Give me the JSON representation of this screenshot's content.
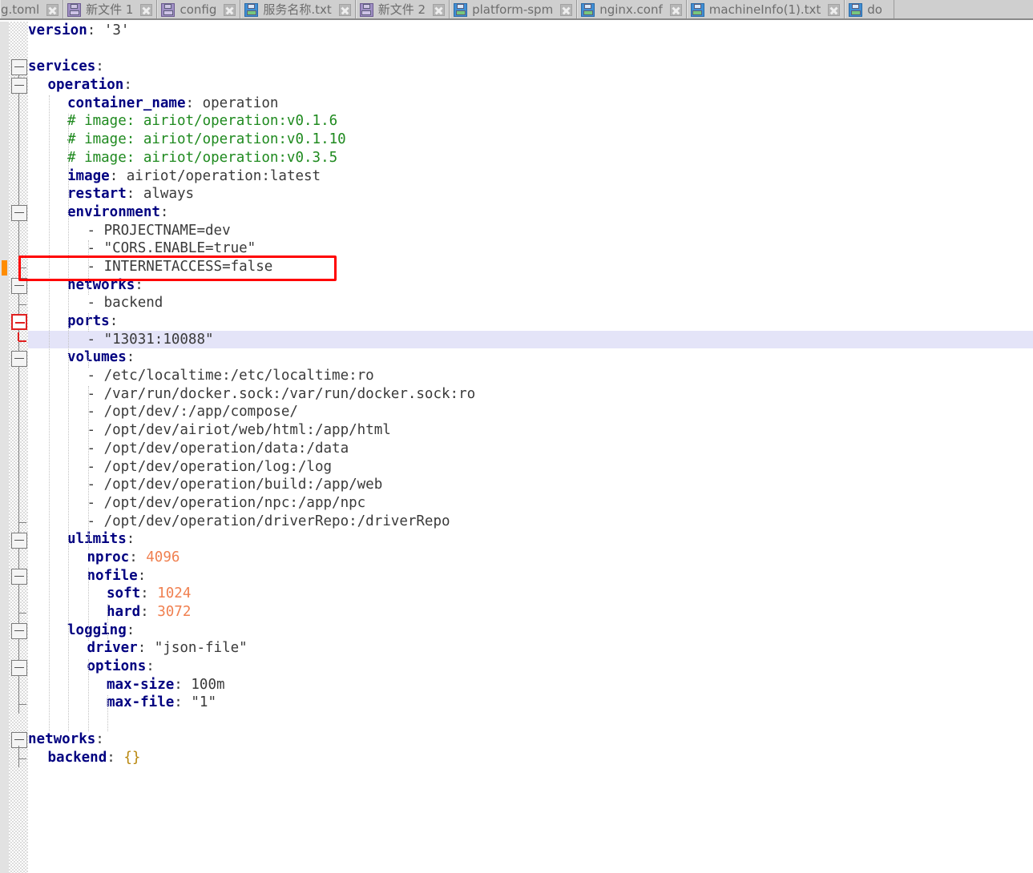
{
  "tabbar": {
    "tabs": [
      {
        "label": "g.toml",
        "icon": "floppy-icon",
        "state": "truncated",
        "close_label": "x"
      },
      {
        "label": "新文件 1",
        "icon": "floppy-icon",
        "state": "modified",
        "close_label": "x"
      },
      {
        "label": "config",
        "icon": "floppy-icon",
        "state": "modified",
        "close_label": "x"
      },
      {
        "label": "服务名称.txt",
        "icon": "floppy-icon",
        "state": "saved",
        "close_label": "x"
      },
      {
        "label": "新文件 2",
        "icon": "floppy-icon",
        "state": "modified",
        "close_label": "x"
      },
      {
        "label": "platform-spm",
        "icon": "floppy-icon",
        "state": "saved",
        "close_label": "x"
      },
      {
        "label": "nginx.conf",
        "icon": "floppy-icon",
        "state": "saved",
        "close_label": "x"
      },
      {
        "label": "machineInfo(1).txt",
        "icon": "floppy-icon",
        "state": "saved",
        "close_label": "x"
      },
      {
        "label": "do",
        "icon": "floppy-icon",
        "state": "saved",
        "close_label": "x"
      }
    ]
  },
  "annotation": {
    "color": "#ff0000",
    "target_text": "- INTERNETACCESS=false"
  },
  "colors": {
    "key": "#000080",
    "comment": "#1f8a1f",
    "number": "#f08050",
    "value": "#3a3a3a",
    "current_line": "#e4e4f8",
    "change_marker": "#ff8c00",
    "fold_highlight": "#e02020"
  },
  "editor": {
    "language": "yaml",
    "current_line_text": "    - \"13031:10088\"",
    "lines": [
      {
        "n": 1,
        "indent": 0,
        "parts": [
          {
            "t": "version",
            "c": "k"
          },
          {
            "t": ": ",
            "c": "v"
          },
          {
            "t": "'3'",
            "c": "s"
          }
        ]
      },
      {
        "n": 2,
        "indent": 0,
        "parts": []
      },
      {
        "n": 3,
        "indent": 0,
        "parts": [
          {
            "t": "services",
            "c": "k"
          },
          {
            "t": ":",
            "c": "v"
          }
        ]
      },
      {
        "n": 4,
        "indent": 1,
        "parts": [
          {
            "t": "operation",
            "c": "k"
          },
          {
            "t": ":",
            "c": "v"
          }
        ]
      },
      {
        "n": 5,
        "indent": 2,
        "parts": [
          {
            "t": "container_name",
            "c": "k"
          },
          {
            "t": ": operation",
            "c": "v"
          }
        ]
      },
      {
        "n": 6,
        "indent": 2,
        "parts": [
          {
            "t": "# image: airiot/operation:v0.1.6",
            "c": "c"
          }
        ]
      },
      {
        "n": 7,
        "indent": 2,
        "parts": [
          {
            "t": "# image: airiot/operation:v0.1.10",
            "c": "c"
          }
        ]
      },
      {
        "n": 8,
        "indent": 2,
        "parts": [
          {
            "t": "# image: airiot/operation:v0.3.5",
            "c": "c"
          }
        ]
      },
      {
        "n": 9,
        "indent": 2,
        "parts": [
          {
            "t": "image",
            "c": "k"
          },
          {
            "t": ": airiot/operation:latest",
            "c": "v"
          }
        ]
      },
      {
        "n": 10,
        "indent": 2,
        "parts": [
          {
            "t": "restart",
            "c": "k"
          },
          {
            "t": ": always",
            "c": "v"
          }
        ]
      },
      {
        "n": 11,
        "indent": 2,
        "parts": [
          {
            "t": "environment",
            "c": "k"
          },
          {
            "t": ":",
            "c": "v"
          }
        ]
      },
      {
        "n": 12,
        "indent": 3,
        "parts": [
          {
            "t": "- PROJECTNAME=dev",
            "c": "v"
          }
        ]
      },
      {
        "n": 13,
        "indent": 3,
        "parts": [
          {
            "t": "- \"CORS.ENABLE=true\"",
            "c": "v"
          }
        ]
      },
      {
        "n": 14,
        "indent": 3,
        "parts": [
          {
            "t": "- INTERNETACCESS=false",
            "c": "v"
          }
        ]
      },
      {
        "n": 15,
        "indent": 2,
        "parts": [
          {
            "t": "networks",
            "c": "k"
          },
          {
            "t": ":",
            "c": "v"
          }
        ]
      },
      {
        "n": 16,
        "indent": 3,
        "parts": [
          {
            "t": "- backend",
            "c": "v"
          }
        ]
      },
      {
        "n": 17,
        "indent": 2,
        "parts": [
          {
            "t": "ports",
            "c": "k"
          },
          {
            "t": ":",
            "c": "v"
          }
        ]
      },
      {
        "n": 18,
        "indent": 3,
        "parts": [
          {
            "t": "- \"13031:10088\"",
            "c": "v"
          }
        ],
        "current": true
      },
      {
        "n": 19,
        "indent": 2,
        "parts": [
          {
            "t": "volumes",
            "c": "k"
          },
          {
            "t": ":",
            "c": "v"
          }
        ]
      },
      {
        "n": 20,
        "indent": 3,
        "parts": [
          {
            "t": "- /etc/localtime:/etc/localtime:ro",
            "c": "v"
          }
        ]
      },
      {
        "n": 21,
        "indent": 3,
        "parts": [
          {
            "t": "- /var/run/docker.sock:/var/run/docker.sock:ro",
            "c": "v"
          }
        ]
      },
      {
        "n": 22,
        "indent": 3,
        "parts": [
          {
            "t": "- /opt/dev/:/app/compose/",
            "c": "v"
          }
        ]
      },
      {
        "n": 23,
        "indent": 3,
        "parts": [
          {
            "t": "- /opt/dev/airiot/web/html:/app/html",
            "c": "v"
          }
        ]
      },
      {
        "n": 24,
        "indent": 3,
        "parts": [
          {
            "t": "- /opt/dev/operation/data:/data",
            "c": "v"
          }
        ]
      },
      {
        "n": 25,
        "indent": 3,
        "parts": [
          {
            "t": "- /opt/dev/operation/log:/log",
            "c": "v"
          }
        ]
      },
      {
        "n": 26,
        "indent": 3,
        "parts": [
          {
            "t": "- /opt/dev/operation/build:/app/web",
            "c": "v"
          }
        ]
      },
      {
        "n": 27,
        "indent": 3,
        "parts": [
          {
            "t": "- /opt/dev/operation/npc:/app/npc",
            "c": "v"
          }
        ]
      },
      {
        "n": 28,
        "indent": 3,
        "parts": [
          {
            "t": "- /opt/dev/operation/driverRepo:/driverRepo",
            "c": "v"
          }
        ]
      },
      {
        "n": 29,
        "indent": 2,
        "parts": [
          {
            "t": "ulimits",
            "c": "k"
          },
          {
            "t": ":",
            "c": "v"
          }
        ]
      },
      {
        "n": 30,
        "indent": 3,
        "parts": [
          {
            "t": "nproc",
            "c": "k"
          },
          {
            "t": ": ",
            "c": "v"
          },
          {
            "t": "4096",
            "c": "n"
          }
        ]
      },
      {
        "n": 31,
        "indent": 3,
        "parts": [
          {
            "t": "nofile",
            "c": "k"
          },
          {
            "t": ":",
            "c": "v"
          }
        ]
      },
      {
        "n": 32,
        "indent": 4,
        "parts": [
          {
            "t": "soft",
            "c": "k"
          },
          {
            "t": ": ",
            "c": "v"
          },
          {
            "t": "1024",
            "c": "n"
          }
        ]
      },
      {
        "n": 33,
        "indent": 4,
        "parts": [
          {
            "t": "hard",
            "c": "k"
          },
          {
            "t": ": ",
            "c": "v"
          },
          {
            "t": "3072",
            "c": "n"
          }
        ]
      },
      {
        "n": 34,
        "indent": 2,
        "parts": [
          {
            "t": "logging",
            "c": "k"
          },
          {
            "t": ":",
            "c": "v"
          }
        ]
      },
      {
        "n": 35,
        "indent": 3,
        "parts": [
          {
            "t": "driver",
            "c": "k"
          },
          {
            "t": ": \"json-file\"",
            "c": "v"
          }
        ]
      },
      {
        "n": 36,
        "indent": 3,
        "parts": [
          {
            "t": "options",
            "c": "k"
          },
          {
            "t": ":",
            "c": "v"
          }
        ]
      },
      {
        "n": 37,
        "indent": 4,
        "parts": [
          {
            "t": "max-size",
            "c": "k"
          },
          {
            "t": ": 100m",
            "c": "v"
          }
        ]
      },
      {
        "n": 38,
        "indent": 4,
        "parts": [
          {
            "t": "max-file",
            "c": "k"
          },
          {
            "t": ": \"1\"",
            "c": "v"
          }
        ]
      },
      {
        "n": 39,
        "indent": 0,
        "parts": []
      },
      {
        "n": 40,
        "indent": 0,
        "parts": [
          {
            "t": "networks",
            "c": "k"
          },
          {
            "t": ":",
            "c": "v"
          }
        ]
      },
      {
        "n": 41,
        "indent": 1,
        "parts": [
          {
            "t": "backend",
            "c": "k"
          },
          {
            "t": ": ",
            "c": "v"
          },
          {
            "t": "{}",
            "c": "br"
          }
        ]
      }
    ]
  }
}
